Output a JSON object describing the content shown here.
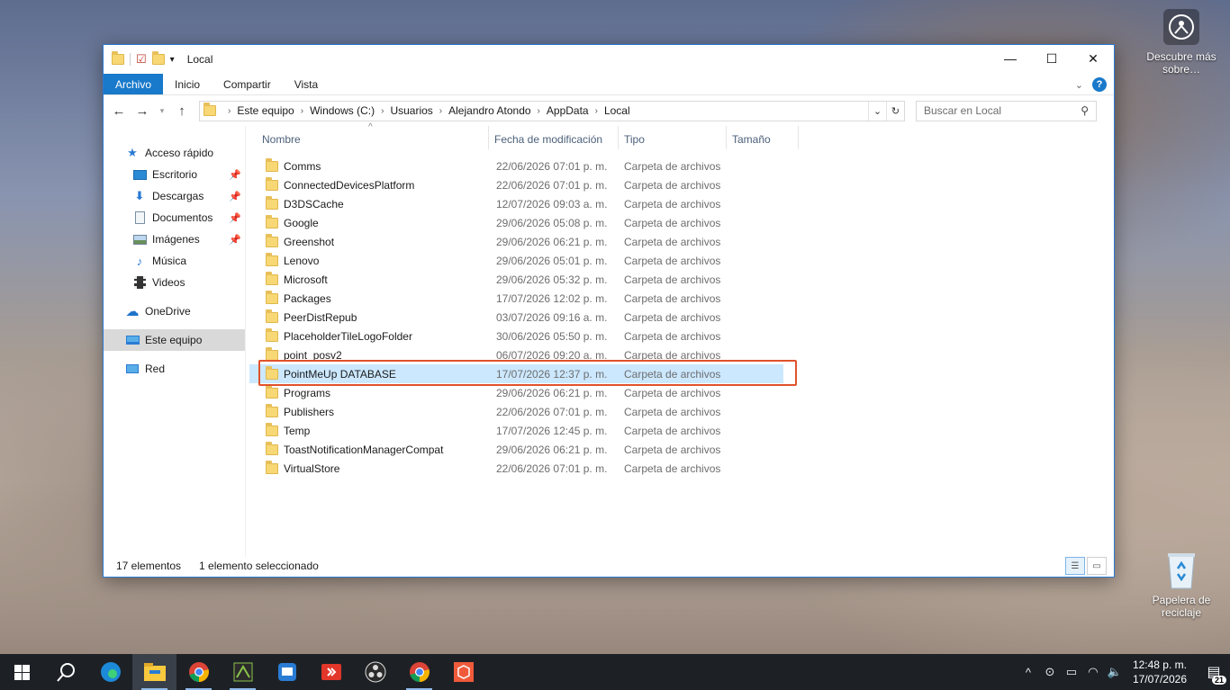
{
  "desktop": {
    "spotlight_label": "Descubre más sobre…",
    "recycle_label": "Papelera de reciclaje"
  },
  "window": {
    "title": "Local",
    "controls": {
      "minimize": "—",
      "maximize": "☐",
      "close": "✕"
    }
  },
  "ribbon": {
    "tabs": [
      "Archivo",
      "Inicio",
      "Compartir",
      "Vista"
    ],
    "help": "?"
  },
  "address": {
    "crumbs": [
      "Este equipo",
      "Windows (C:)",
      "Usuarios",
      "Alejandro Atondo",
      "AppData",
      "Local"
    ],
    "search_placeholder": "Buscar en Local"
  },
  "nav": {
    "quick_access": "Acceso rápido",
    "quick_items": [
      "Escritorio",
      "Descargas",
      "Documentos",
      "Imágenes",
      "Música",
      "Videos"
    ],
    "onedrive": "OneDrive",
    "this_pc": "Este equipo",
    "network": "Red"
  },
  "columns": {
    "name": "Nombre",
    "date": "Fecha de modificación",
    "type": "Tipo",
    "size": "Tamaño"
  },
  "files": [
    {
      "name": "Comms",
      "date": "22/06/2026 07:01 p. m.",
      "type": "Carpeta de archivos"
    },
    {
      "name": "ConnectedDevicesPlatform",
      "date": "22/06/2026 07:01 p. m.",
      "type": "Carpeta de archivos"
    },
    {
      "name": "D3DSCache",
      "date": "12/07/2026 09:03 a. m.",
      "type": "Carpeta de archivos"
    },
    {
      "name": "Google",
      "date": "29/06/2026 05:08 p. m.",
      "type": "Carpeta de archivos"
    },
    {
      "name": "Greenshot",
      "date": "29/06/2026 06:21 p. m.",
      "type": "Carpeta de archivos"
    },
    {
      "name": "Lenovo",
      "date": "29/06/2026 05:01 p. m.",
      "type": "Carpeta de archivos"
    },
    {
      "name": "Microsoft",
      "date": "29/06/2026 05:32 p. m.",
      "type": "Carpeta de archivos"
    },
    {
      "name": "Packages",
      "date": "17/07/2026 12:02 p. m.",
      "type": "Carpeta de archivos"
    },
    {
      "name": "PeerDistRepub",
      "date": "03/07/2026 09:16 a. m.",
      "type": "Carpeta de archivos"
    },
    {
      "name": "PlaceholderTileLogoFolder",
      "date": "30/06/2026 05:50 p. m.",
      "type": "Carpeta de archivos"
    },
    {
      "name": "point_posv2",
      "date": "06/07/2026 09:20 a. m.",
      "type": "Carpeta de archivos"
    },
    {
      "name": "PointMeUp DATABASE",
      "date": "17/07/2026 12:37 p. m.",
      "type": "Carpeta de archivos"
    },
    {
      "name": "Programs",
      "date": "29/06/2026 06:21 p. m.",
      "type": "Carpeta de archivos"
    },
    {
      "name": "Publishers",
      "date": "22/06/2026 07:01 p. m.",
      "type": "Carpeta de archivos"
    },
    {
      "name": "Temp",
      "date": "17/07/2026 12:45 p. m.",
      "type": "Carpeta de archivos"
    },
    {
      "name": "ToastNotificationManagerCompat",
      "date": "29/06/2026 06:21 p. m.",
      "type": "Carpeta de archivos"
    },
    {
      "name": "VirtualStore",
      "date": "22/06/2026 07:01 p. m.",
      "type": "Carpeta de archivos"
    }
  ],
  "selected_index": 11,
  "status": {
    "count": "17 elementos",
    "selection": "1 elemento seleccionado"
  },
  "taskbar": {
    "time": "12:48 p. m.",
    "date": "17/07/2026",
    "notifications": "21"
  },
  "colors": {
    "accent": "#1979ca",
    "selection": "#cce8ff",
    "highlight_box": "#e0522b"
  }
}
